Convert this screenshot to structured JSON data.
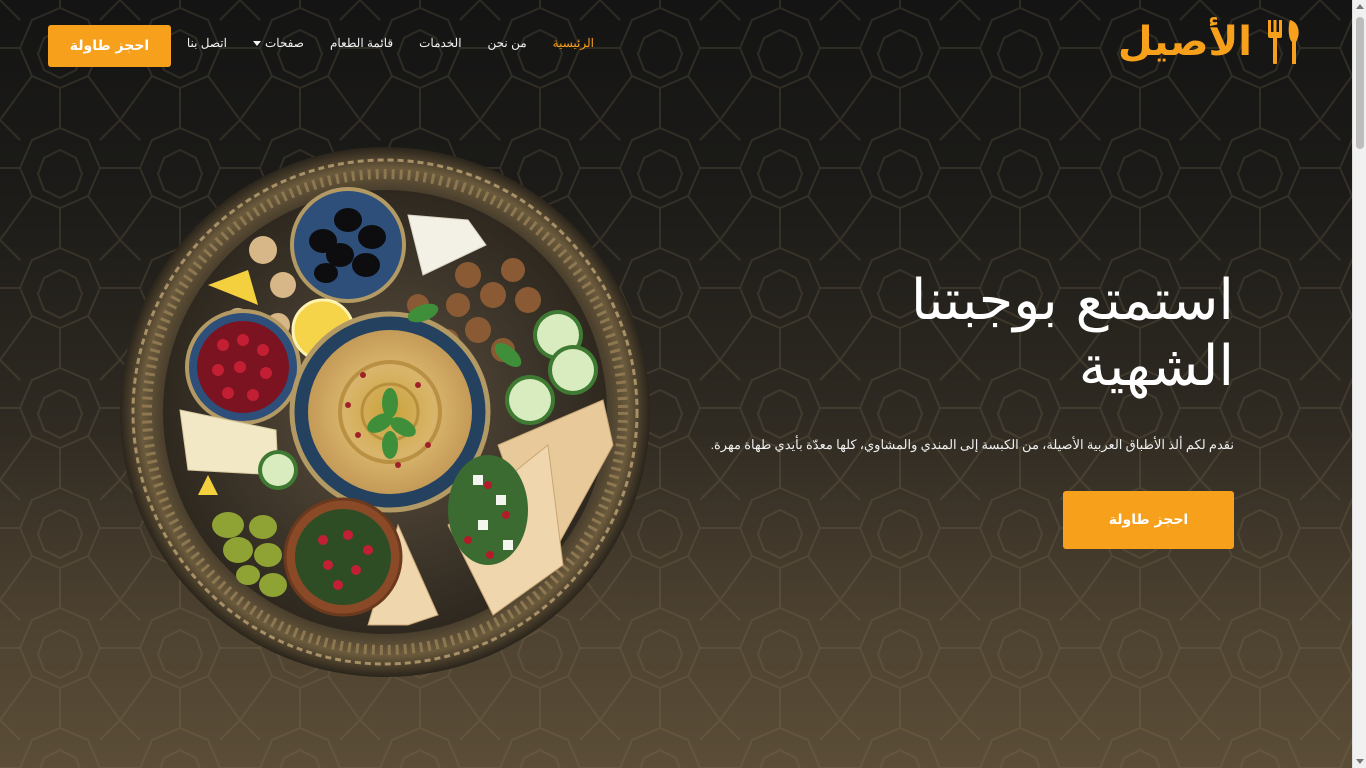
{
  "brand": {
    "name": "الأصيل",
    "accent_color": "#f7a01b"
  },
  "nav": {
    "items": [
      {
        "label": "الرئيسية",
        "active": true
      },
      {
        "label": "من نحن"
      },
      {
        "label": "الخدمات"
      },
      {
        "label": "قائمة الطعام"
      },
      {
        "label": "صفحات",
        "has_dropdown": true
      },
      {
        "label": "اتصل بنا"
      }
    ]
  },
  "header": {
    "cta_label": "احجز طاولة"
  },
  "hero": {
    "title_line1": "استمتع بوجبتنا",
    "title_line2": "الشهية",
    "subtitle": "نقدم لكم ألذ الأطباق العربية الأصيلة، من الكبسة إلى المندي والمشاوي، كلها معدّة بأيدي طهاة مهرة.",
    "cta_label": "احجز طاولة",
    "image": "mezze-platter-image"
  }
}
